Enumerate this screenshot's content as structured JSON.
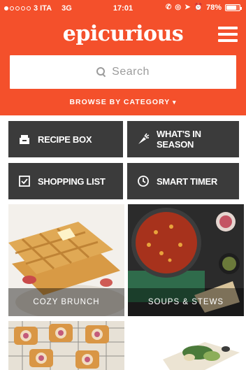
{
  "status_bar": {
    "carrier": "3 ITA",
    "network": "3G",
    "time": "17:01",
    "battery": "78%",
    "battery_level": 0.78
  },
  "header": {
    "logo": "epicurious",
    "menu_icon": "hamburger-icon",
    "search": {
      "placeholder": "Search",
      "icon": "search-icon"
    },
    "browse_label": "BROWSE BY CATEGORY",
    "browse_caret": "▾"
  },
  "nav_buttons": [
    {
      "label": "RECIPE BOX",
      "icon": "recipe-box-icon"
    },
    {
      "label": "WHAT'S IN SEASON",
      "icon": "carrot-icon"
    },
    {
      "label": "SHOPPING LIST",
      "icon": "checkbox-icon"
    },
    {
      "label": "SMART TIMER",
      "icon": "clock-icon"
    }
  ],
  "categories": [
    {
      "label": "COZY BRUNCH"
    },
    {
      "label": "SOUPS & STEWS"
    }
  ],
  "colors": {
    "brand_orange": "#f4502b",
    "button_dark": "#3b3b3b"
  }
}
